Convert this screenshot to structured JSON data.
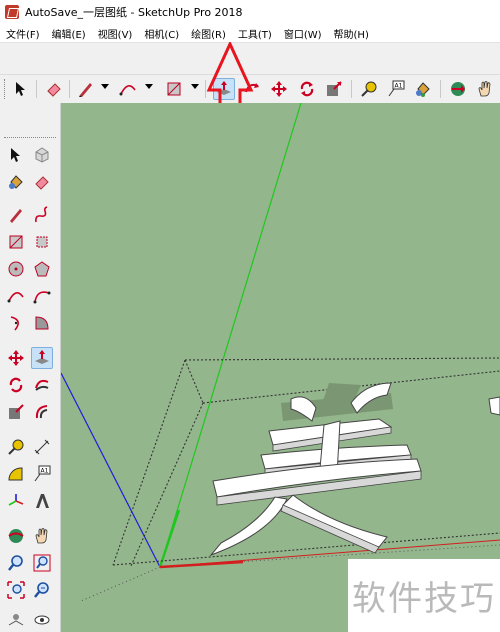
{
  "window": {
    "title": "AutoSave_一层图纸 - SketchUp Pro 2018"
  },
  "menubar": {
    "items": [
      {
        "label": "文件(F)"
      },
      {
        "label": "编辑(E)"
      },
      {
        "label": "视图(V)"
      },
      {
        "label": "相机(C)"
      },
      {
        "label": "绘图(R)"
      },
      {
        "label": "工具(T)"
      },
      {
        "label": "窗口(W)"
      },
      {
        "label": "帮助(H)"
      }
    ]
  },
  "toolbar": {
    "icons": [
      "select-icon",
      "eraser-icon",
      "pencil-line-icon",
      "arc-icon",
      "rectangle-icon",
      "push-pull-icon",
      "rotate-icon",
      "move-icon",
      "scale-icon",
      "follow-me-icon",
      "tape-measure-icon",
      "text-label-icon",
      "paint-bucket-icon",
      "section-plane-icon",
      "hand-pan-icon"
    ],
    "active": "push-pull-icon"
  },
  "sidebar": {
    "active": "push-pull-icon"
  },
  "annotation": {
    "color": "#e8141e"
  },
  "viewport": {
    "background": "#94b68c",
    "axis_colors": {
      "red": "#d21e1e",
      "green": "#1ec81e",
      "blue": "#1e1edc"
    },
    "model_text": "美"
  },
  "watermark": {
    "text": "软件技巧"
  }
}
